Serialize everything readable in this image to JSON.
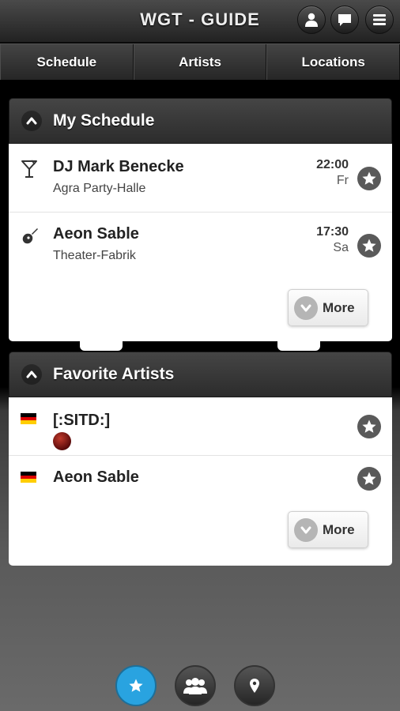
{
  "header": {
    "title": "WGT - GUIDE",
    "buttons": [
      "user-icon",
      "chat-icon",
      "menu-icon"
    ]
  },
  "navbar": {
    "tabs": [
      {
        "label": "Schedule"
      },
      {
        "label": "Artists"
      },
      {
        "label": "Locations"
      }
    ]
  },
  "my_schedule": {
    "title": "My Schedule",
    "items": [
      {
        "icon": "cocktail-icon",
        "title": "DJ Mark Benecke",
        "venue": "Agra Party-Halle",
        "time": "22:00",
        "day": "Fr"
      },
      {
        "icon": "guitar-icon",
        "title": "Aeon Sable",
        "venue": "Theater-Fabrik",
        "time": "17:30",
        "day": "Sa"
      }
    ],
    "more_label": "More"
  },
  "favorite_artists": {
    "title": "Favorite Artists",
    "items": [
      {
        "flag": "germany-flag",
        "name": "[:SITD:]"
      },
      {
        "flag": "germany-flag",
        "name": "Aeon Sable"
      }
    ],
    "more_label": "More"
  },
  "bottom_bar": {
    "buttons": [
      "star-icon",
      "people-icon",
      "location-pin-icon"
    ],
    "active": "star-icon",
    "active_color": "#29a3e0"
  },
  "colors": {
    "panel_header": "#383838",
    "star_button": "#5a5a5a"
  }
}
